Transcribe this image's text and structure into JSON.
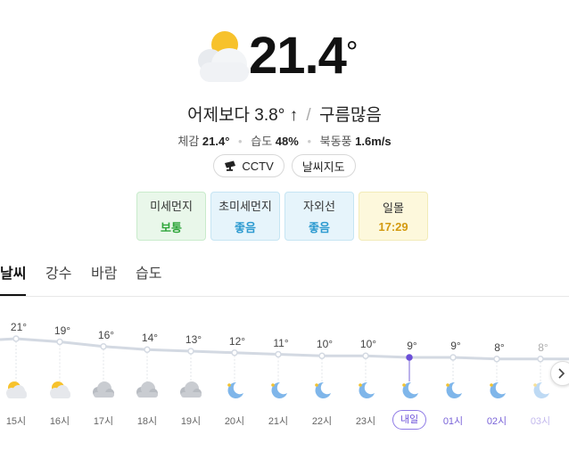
{
  "current": {
    "temperature": "21.4",
    "degree": "°",
    "icon": "sun-behind-cloud-icon",
    "compare_text": "어제보다 3.8° ↑",
    "condition": "구름많음",
    "feels_like_label": "체감",
    "feels_like_value": "21.4°",
    "humidity_label": "습도",
    "humidity_value": "48%",
    "wind_label": "북동풍",
    "wind_value": "1.6m/s"
  },
  "chips": {
    "cctv": "CCTV",
    "weather_map": "날씨지도"
  },
  "cards": [
    {
      "label": "미세먼지",
      "value": "보통",
      "bg": "#e9f7ea",
      "border": "#c9ebcc",
      "color": "#2ea53a"
    },
    {
      "label": "초미세먼지",
      "value": "좋음",
      "bg": "#e6f4fb",
      "border": "#c6e5f3",
      "color": "#2d9ad0"
    },
    {
      "label": "자외선",
      "value": "좋음",
      "bg": "#e6f4fb",
      "border": "#c6e5f3",
      "color": "#2d9ad0"
    },
    {
      "label": "일몰",
      "value": "17:29",
      "bg": "#fdf8dc",
      "border": "#f2ebb8",
      "color": "#d39a10"
    }
  ],
  "tabs": [
    "날씨",
    "강수",
    "바람",
    "습도"
  ],
  "active_tab": "날씨",
  "hourly": [
    {
      "temp": 21,
      "label": "21°",
      "hour": "15시",
      "icon": "partly-cloudy-sun-icon"
    },
    {
      "temp": 19,
      "label": "19°",
      "hour": "16시",
      "icon": "partly-cloudy-sun-icon"
    },
    {
      "temp": 16,
      "label": "16°",
      "hour": "17시",
      "icon": "cloudy-icon"
    },
    {
      "temp": 14,
      "label": "14°",
      "hour": "18시",
      "icon": "cloudy-icon"
    },
    {
      "temp": 13,
      "label": "13°",
      "hour": "19시",
      "icon": "cloudy-icon"
    },
    {
      "temp": 12,
      "label": "12°",
      "hour": "20시",
      "icon": "moon-icon"
    },
    {
      "temp": 11,
      "label": "11°",
      "hour": "21시",
      "icon": "moon-icon"
    },
    {
      "temp": 10,
      "label": "10°",
      "hour": "22시",
      "icon": "moon-icon"
    },
    {
      "temp": 10,
      "label": "10°",
      "hour": "23시",
      "icon": "moon-icon"
    },
    {
      "temp": 9,
      "label": "9°",
      "hour": "내일",
      "icon": "moon-icon"
    },
    {
      "temp": 9,
      "label": "9°",
      "hour": "01시",
      "icon": "moon-icon"
    },
    {
      "temp": 8,
      "label": "8°",
      "hour": "02시",
      "icon": "moon-icon"
    },
    {
      "temp": 8,
      "label": "8°",
      "hour": "03시",
      "icon": "moon-icon"
    }
  ],
  "next_icon": "chevron-right-icon"
}
